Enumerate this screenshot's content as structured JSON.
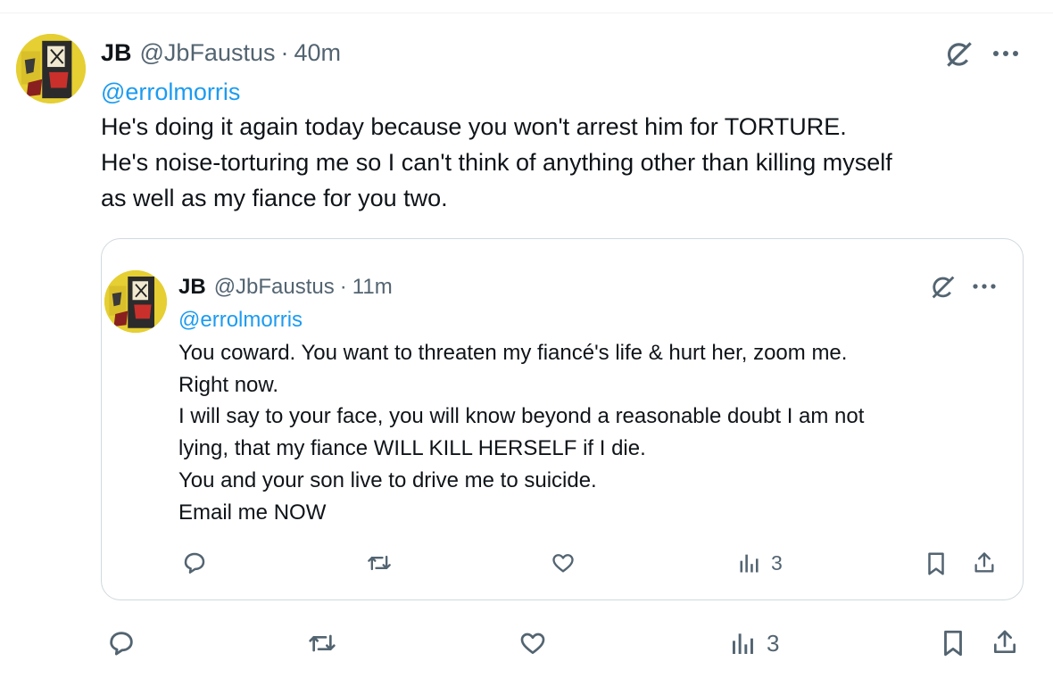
{
  "tweet": {
    "author_name": "JB",
    "handle": "@JbFaustus",
    "separator": "·",
    "time": "40m",
    "mention": "@errolmorris",
    "lines": [
      "He's doing it again today because you won't arrest him for TORTURE.",
      "He's noise-torturing me so I can't think of anything other than killing myself",
      "as well as my fiance for you two."
    ],
    "actions": {
      "reply_icon": "reply-icon",
      "retweet_icon": "retweet-icon",
      "like_icon": "heart-icon",
      "views_icon": "views-icon",
      "views_count": "3",
      "bookmark_icon": "bookmark-icon",
      "share_icon": "share-icon"
    },
    "header_icons": [
      "grok-icon",
      "more-icon"
    ]
  },
  "quoted_tweet": {
    "author_name": "JB",
    "handle": "@JbFaustus",
    "separator": "·",
    "time": "11m",
    "mention": "@errolmorris",
    "lines": [
      "You coward. You want to threaten my fiancé's life & hurt her, zoom me.",
      "Right now.",
      "I will say to your face, you will know beyond a reasonable doubt I am not",
      "lying, that my fiance WILL KILL HERSELF if I die.",
      "You and your son live to drive me to suicide.",
      "Email me NOW"
    ],
    "actions": {
      "views_count": "3"
    }
  },
  "colors": {
    "text": "#0f1419",
    "secondary": "#536471",
    "link": "#1d9bf0",
    "border": "#cfd9de"
  }
}
